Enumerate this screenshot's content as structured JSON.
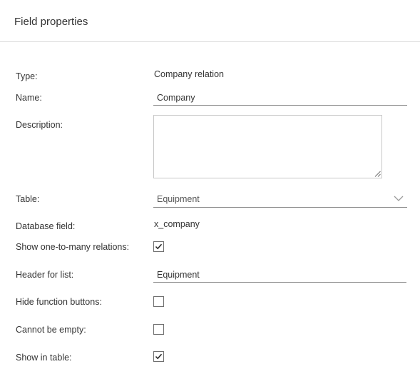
{
  "header": {
    "title": "Field properties"
  },
  "fields": {
    "type": {
      "label": "Type:",
      "value": "Company relation"
    },
    "name": {
      "label": "Name:",
      "value": "Company"
    },
    "description": {
      "label": "Description:",
      "value": ""
    },
    "table": {
      "label": "Table:",
      "selected": "Equipment"
    },
    "database_field": {
      "label": "Database field:",
      "value": "x_company"
    },
    "show_one_to_many": {
      "label": "Show one-to-many relations:",
      "checked": true
    },
    "header_for_list": {
      "label": "Header for list:",
      "value": "Equipment"
    },
    "hide_function_buttons": {
      "label": "Hide function buttons:",
      "checked": false
    },
    "cannot_be_empty": {
      "label": "Cannot be empty:",
      "checked": false
    },
    "show_in_table": {
      "label": "Show in table:",
      "checked": true
    }
  },
  "icons": {
    "dropdown": "chevron-down-icon",
    "check": "checkmark-icon",
    "resize": "resize-grip-icon"
  },
  "colors": {
    "underline": "#8a8a8a",
    "border": "#c8c8c8",
    "text": "#333333"
  }
}
